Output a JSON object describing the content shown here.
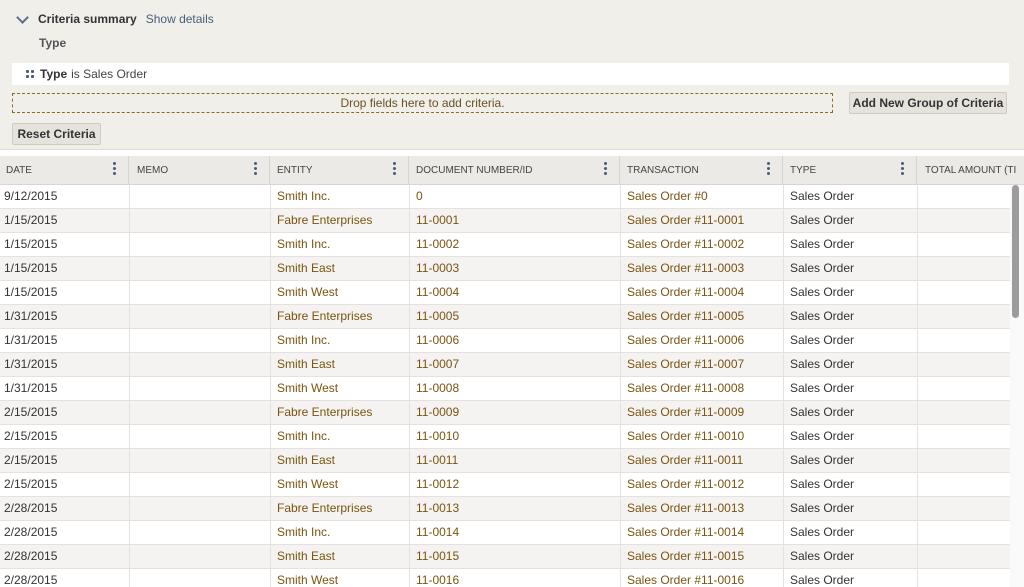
{
  "criteria": {
    "summary_title": "Criteria summary",
    "show_details": "Show details",
    "type_label": "Type",
    "filter": {
      "field": "Type",
      "text": "is Sales Order"
    },
    "drop_hint": "Drop fields here to add criteria.",
    "add_group_label": "Add New Group of Criteria",
    "reset_label": "Reset Criteria"
  },
  "grid": {
    "columns": [
      "DATE",
      "MEMO",
      "ENTITY",
      "DOCUMENT NUMBER/ID",
      "TRANSACTION",
      "TYPE",
      "TOTAL AMOUNT (TI"
    ],
    "rows": [
      {
        "date": "9/12/2015",
        "memo": "",
        "entity": "Smith Inc.",
        "doc": "0",
        "transaction": "Sales Order #0",
        "type": "Sales Order"
      },
      {
        "date": "1/15/2015",
        "memo": "",
        "entity": "Fabre Enterprises",
        "doc": "11-0001",
        "transaction": "Sales Order #11-0001",
        "type": "Sales Order"
      },
      {
        "date": "1/15/2015",
        "memo": "",
        "entity": "Smith Inc.",
        "doc": "11-0002",
        "transaction": "Sales Order #11-0002",
        "type": "Sales Order"
      },
      {
        "date": "1/15/2015",
        "memo": "",
        "entity": "Smith East",
        "doc": "11-0003",
        "transaction": "Sales Order #11-0003",
        "type": "Sales Order"
      },
      {
        "date": "1/15/2015",
        "memo": "",
        "entity": "Smith West",
        "doc": "11-0004",
        "transaction": "Sales Order #11-0004",
        "type": "Sales Order"
      },
      {
        "date": "1/31/2015",
        "memo": "",
        "entity": "Fabre Enterprises",
        "doc": "11-0005",
        "transaction": "Sales Order #11-0005",
        "type": "Sales Order"
      },
      {
        "date": "1/31/2015",
        "memo": "",
        "entity": "Smith Inc.",
        "doc": "11-0006",
        "transaction": "Sales Order #11-0006",
        "type": "Sales Order"
      },
      {
        "date": "1/31/2015",
        "memo": "",
        "entity": "Smith East",
        "doc": "11-0007",
        "transaction": "Sales Order #11-0007",
        "type": "Sales Order"
      },
      {
        "date": "1/31/2015",
        "memo": "",
        "entity": "Smith West",
        "doc": "11-0008",
        "transaction": "Sales Order #11-0008",
        "type": "Sales Order"
      },
      {
        "date": "2/15/2015",
        "memo": "",
        "entity": "Fabre Enterprises",
        "doc": "11-0009",
        "transaction": "Sales Order #11-0009",
        "type": "Sales Order"
      },
      {
        "date": "2/15/2015",
        "memo": "",
        "entity": "Smith Inc.",
        "doc": "11-0010",
        "transaction": "Sales Order #11-0010",
        "type": "Sales Order"
      },
      {
        "date": "2/15/2015",
        "memo": "",
        "entity": "Smith East",
        "doc": "11-0011",
        "transaction": "Sales Order #11-0011",
        "type": "Sales Order"
      },
      {
        "date": "2/15/2015",
        "memo": "",
        "entity": "Smith West",
        "doc": "11-0012",
        "transaction": "Sales Order #11-0012",
        "type": "Sales Order"
      },
      {
        "date": "2/28/2015",
        "memo": "",
        "entity": "Fabre Enterprises",
        "doc": "11-0013",
        "transaction": "Sales Order #11-0013",
        "type": "Sales Order"
      },
      {
        "date": "2/28/2015",
        "memo": "",
        "entity": "Smith Inc.",
        "doc": "11-0014",
        "transaction": "Sales Order #11-0014",
        "type": "Sales Order"
      },
      {
        "date": "2/28/2015",
        "memo": "",
        "entity": "Smith East",
        "doc": "11-0015",
        "transaction": "Sales Order #11-0015",
        "type": "Sales Order"
      },
      {
        "date": "2/28/2015",
        "memo": "",
        "entity": "Smith West",
        "doc": "11-0016",
        "transaction": "Sales Order #11-0016",
        "type": "Sales Order"
      }
    ]
  },
  "icons": {
    "collapse": "chevron-down-icon",
    "drag": "drag-handle-icon",
    "column_menu": "kebab-menu-icon"
  }
}
